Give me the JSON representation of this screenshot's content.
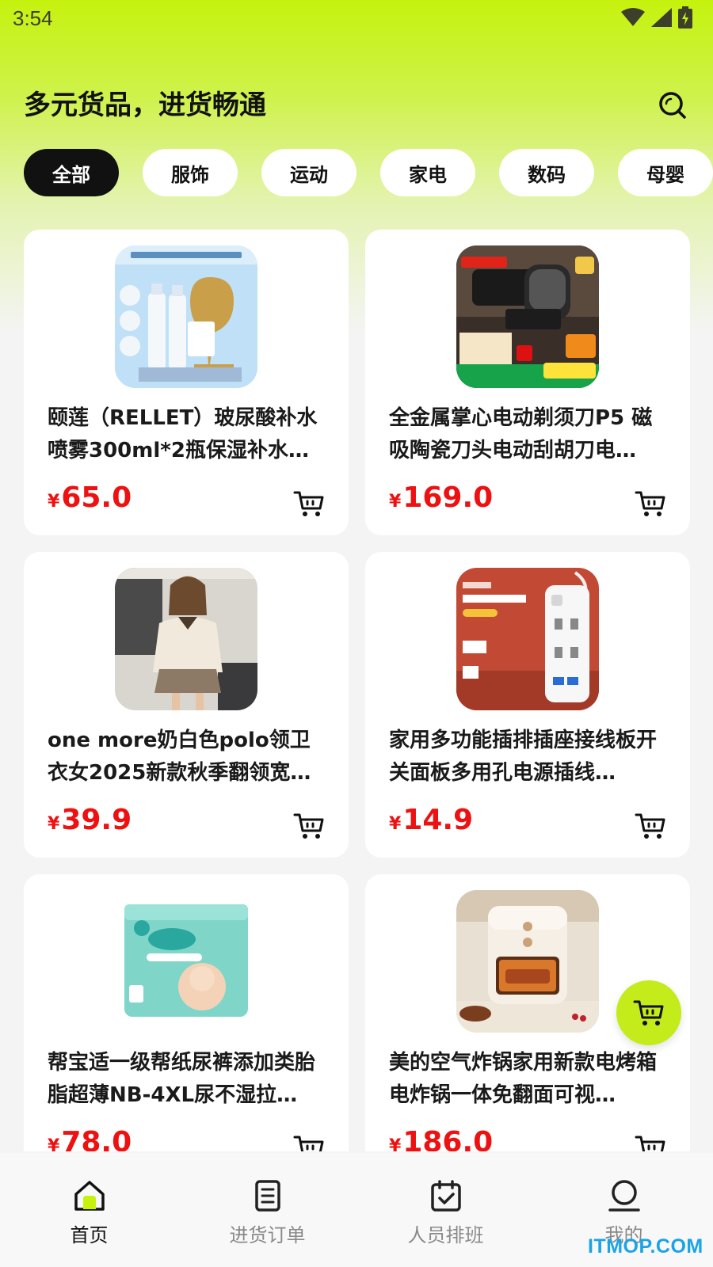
{
  "status_bar": {
    "time": "3:54"
  },
  "header": {
    "title": "多元货品，进货畅通"
  },
  "tabs": [
    {
      "label": "全部",
      "active": true
    },
    {
      "label": "服饰",
      "active": false
    },
    {
      "label": "运动",
      "active": false
    },
    {
      "label": "家电",
      "active": false
    },
    {
      "label": "数码",
      "active": false
    },
    {
      "label": "母婴",
      "active": false
    }
  ],
  "products": [
    {
      "title": "颐莲（RELLET）玻尿酸补水喷雾300ml*2瓶保湿补水…",
      "currency": "¥",
      "price": "65.0",
      "image": "blue-spray-bottles-trophy"
    },
    {
      "title": "全金属掌心电动剃须刀P5 磁吸陶瓷刀头电动刮胡刀电…",
      "currency": "¥",
      "price": "169.0",
      "image": "black-electric-shaver"
    },
    {
      "title": "one more奶白色polo领卫衣女2025新款秋季翻领宽松…",
      "currency": "¥",
      "price": "39.9",
      "image": "woman-cream-sweatshirt"
    },
    {
      "title": "家用多功能插排插座接线板开关面板多用孔电源插线…",
      "currency": "¥",
      "price": "14.9",
      "image": "white-power-strip"
    },
    {
      "title": "帮宝适一级帮纸尿裤添加类胎脂超薄NB-4XL尿不湿拉…",
      "currency": "¥",
      "price": "78.0",
      "image": "pampers-diaper-pack"
    },
    {
      "title": "美的空气炸锅家用新款电烤箱电炸锅一体免翻面可视…",
      "currency": "¥",
      "price": "186.0",
      "image": "cream-air-fryer"
    }
  ],
  "bottom_nav": [
    {
      "label": "首页",
      "icon": "home-icon",
      "active": true
    },
    {
      "label": "进货订单",
      "icon": "document-icon",
      "active": false
    },
    {
      "label": "人员排班",
      "icon": "calendar-check-icon",
      "active": false
    },
    {
      "label": "我的",
      "icon": "user-icon",
      "active": false
    }
  ],
  "watermark": "ITMOP.COM",
  "colors": {
    "accent": "#c6f20e",
    "price": "#ee1111",
    "active_tab": "#111111"
  }
}
